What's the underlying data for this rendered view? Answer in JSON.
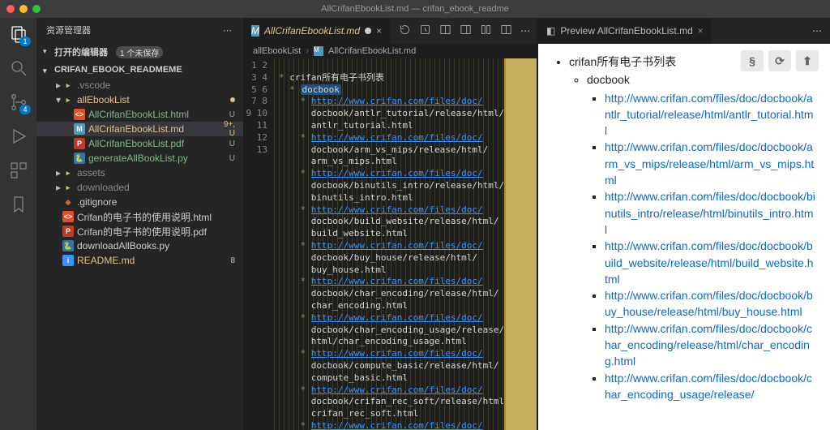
{
  "window_title": "AllCrifanEbookList.md — crifan_ebook_readme",
  "sidebar_title": "资源管理器",
  "open_editors": {
    "label": "打开的编辑器",
    "badge": "1 个未保存"
  },
  "project_name": "CRIFAN_EBOOK_READMEME",
  "tree": [
    {
      "indent": 1,
      "type": "folder",
      "open": false,
      "name": ".vscode",
      "cls": "c-dim"
    },
    {
      "indent": 1,
      "type": "folder",
      "open": true,
      "name": "allEbookList",
      "cls": "c-amber",
      "dot": true
    },
    {
      "indent": 2,
      "type": "file",
      "icon": "ic-html",
      "name": "AllCrifanEbookList.html",
      "cls": "c-green",
      "mark": "U"
    },
    {
      "indent": 2,
      "type": "file",
      "icon": "ic-md",
      "name": "AllCrifanEbookList.md",
      "cls": "c-amber",
      "mark": "9+, U",
      "selected": true
    },
    {
      "indent": 2,
      "type": "file",
      "icon": "ic-pdf",
      "name": "AllCrifanEbookList.pdf",
      "cls": "c-green",
      "mark": "U"
    },
    {
      "indent": 2,
      "type": "file",
      "icon": "ic-py",
      "name": "generateAllBookList.py",
      "cls": "c-green",
      "mark": "U"
    },
    {
      "indent": 1,
      "type": "folder",
      "open": false,
      "name": "assets",
      "cls": "c-dim"
    },
    {
      "indent": 1,
      "type": "folder",
      "open": false,
      "name": "downloaded",
      "cls": "c-dim"
    },
    {
      "indent": 1,
      "type": "file",
      "icon": "ic-git",
      "name": ".gitignore",
      "cls": ""
    },
    {
      "indent": 1,
      "type": "file",
      "icon": "ic-html",
      "name": "Crifan的电子书的使用说明.html",
      "cls": ""
    },
    {
      "indent": 1,
      "type": "file",
      "icon": "ic-pdf",
      "name": "Crifan的电子书的使用说明.pdf",
      "cls": ""
    },
    {
      "indent": 1,
      "type": "file",
      "icon": "ic-py",
      "name": "downloadAllBooks.py",
      "cls": ""
    },
    {
      "indent": 1,
      "type": "file",
      "icon": "ic-info",
      "name": "README.md",
      "cls": "c-amber",
      "mark": "8"
    }
  ],
  "editor_tab": {
    "file": "AllCrifanEbookList.md"
  },
  "breadcrumb": [
    "allEbookList",
    "AllCrifanEbookList.md"
  ],
  "code_lines": [
    "",
    "* crifan所有电子书列表",
    "  * docbook",
    "    * http://www.crifan.com/files/doc/\n      docbook/antlr_tutorial/release/html/\n      antlr_tutorial.html",
    "    * http://www.crifan.com/files/doc/\n      docbook/arm_vs_mips/release/html/\n      arm_vs_mips.html",
    "    * http://www.crifan.com/files/doc/\n      docbook/binutils_intro/release/html/\n      binutils_intro.html",
    "    * http://www.crifan.com/files/doc/\n      docbook/build_website/release/html/\n      build_website.html",
    "    * http://www.crifan.com/files/doc/\n      docbook/buy_house/release/html/\n      buy_house.html",
    "    * http://www.crifan.com/files/doc/\n      docbook/char_encoding/release/html/\n      char_encoding.html",
    "    * http://www.crifan.com/files/doc/\n      docbook/char_encoding_usage/release/\n      html/char_encoding_usage.html",
    "    * http://www.crifan.com/files/doc/\n      docbook/compute_basic/release/html/\n      compute_basic.html",
    "    * http://www.crifan.com/files/doc/\n      docbook/crifan_rec_soft/release/html/\n      crifan_rec_soft.html",
    "    * http://www.crifan.com/files/doc/\n      docbook/crifanlib_csharp/release/html/"
  ],
  "first_line_no": 1,
  "preview_tab": "Preview AllCrifanEbookList.md",
  "preview": {
    "title": "crifan所有电子书列表",
    "sub": "docbook",
    "links": [
      "http://www.crifan.com/files/doc/docbook/antlr_tutorial/release/html/antlr_tutorial.html",
      "http://www.crifan.com/files/doc/docbook/arm_vs_mips/release/html/arm_vs_mips.html",
      "http://www.crifan.com/files/doc/docbook/binutils_intro/release/html/binutils_intro.html",
      "http://www.crifan.com/files/doc/docbook/build_website/release/html/build_website.html",
      "http://www.crifan.com/files/doc/docbook/buy_house/release/html/buy_house.html",
      "http://www.crifan.com/files/doc/docbook/char_encoding/release/html/char_encoding.html",
      "http://www.crifan.com/files/doc/docbook/char_encoding_usage/release/"
    ]
  },
  "float_tools": [
    "§",
    "⟳",
    "⬆"
  ]
}
